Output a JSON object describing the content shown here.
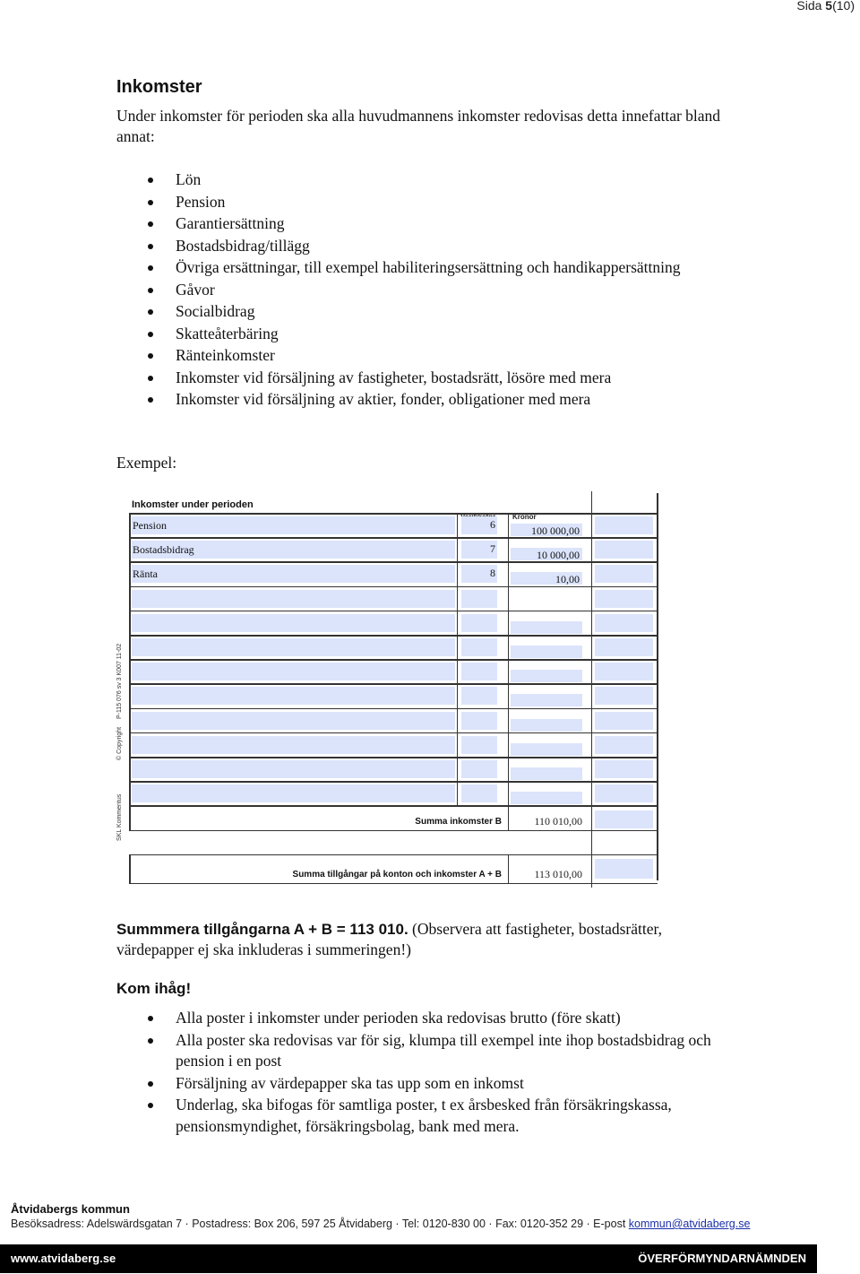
{
  "page_indicator": {
    "prefix": "Sida ",
    "current": "5",
    "total": "(10)"
  },
  "heading": "Inkomster",
  "intro": "Under inkomster för perioden ska alla huvudmannens inkomster redovisas detta innefattar bland annat:",
  "income_types": [
    "Lön",
    "Pension",
    "Garantiersättning",
    "Bostadsbidrag/tillägg",
    "Övriga ersättningar, till exempel habiliteringsersättning och handikappersättning",
    "Gåvor",
    "Socialbidrag",
    "Skatteåterbäring",
    "Ränteinkomster",
    "Inkomster vid försäljning av fastigheter, bostadsrätt, lösöre med mera",
    "Inkomster vid försäljning av aktier, fonder, obligationer med mera"
  ],
  "example_label": "Exempel:",
  "form": {
    "title": "Inkomster under perioden",
    "col_verifikation": "Verifikatnr",
    "col_kronor": "Kronor",
    "rows": [
      {
        "label": "Pension",
        "ver": "6",
        "kronor": "100 000,00"
      },
      {
        "label": "Bostadsbidrag",
        "ver": "7",
        "kronor": "10 000,00"
      },
      {
        "label": "Ränta",
        "ver": "8",
        "kronor": "10,00"
      },
      {
        "label": "",
        "ver": "",
        "kronor": ""
      },
      {
        "label": "",
        "ver": "",
        "kronor": ""
      },
      {
        "label": "",
        "ver": "",
        "kronor": ""
      },
      {
        "label": "",
        "ver": "",
        "kronor": ""
      },
      {
        "label": "",
        "ver": "",
        "kronor": ""
      },
      {
        "label": "",
        "ver": "",
        "kronor": ""
      },
      {
        "label": "",
        "ver": "",
        "kronor": ""
      },
      {
        "label": "",
        "ver": "",
        "kronor": ""
      },
      {
        "label": "",
        "ver": "",
        "kronor": ""
      }
    ],
    "summa_b_label": "Summa inkomster B",
    "summa_b_value": "110 010,00",
    "summa_ab_label": "Summa tillgångar på konton och inkomster A + B",
    "summa_ab_value": "113 010,00",
    "side_text_1": "SKL Kommentus",
    "side_text_2": "© Copyright",
    "side_text_3": "P-115 076  sv 3 K007 11-02"
  },
  "summary": {
    "bold": "Summmera tillgångarna A + B = 113 010.",
    "note": " (Observera att fastigheter, bostadsrätter, värdepapper ej ska inkluderas i summeringen!)"
  },
  "remember_heading": "Kom ihåg!",
  "remember_items": [
    "Alla poster i inkomster under perioden ska redovisas brutto (före skatt)",
    "Alla poster ska redovisas var för sig, klumpa till exempel inte ihop bostadsbidrag och pension i en post",
    "Försäljning av värdepapper ska tas upp som en inkomst",
    "Underlag, ska bifogas för samtliga poster, t ex årsbesked från försäkringskassa, pensionsmyndighet, försäkringsbolag, bank med mera."
  ],
  "footer": {
    "org": "Åtvidabergs kommun",
    "address": "Besöksadress: Adelswärdsgatan 7  ·  Postadress: Box 206, 597 25 Åtvidaberg  ·  Tel: 0120-830 00 · Fax: 0120-352 29  ·  E-post ",
    "email": "kommun@atvidaberg.se",
    "website": "www.atvidaberg.se",
    "department": "ÖVERFÖRMYNDARNÄMNDEN"
  }
}
